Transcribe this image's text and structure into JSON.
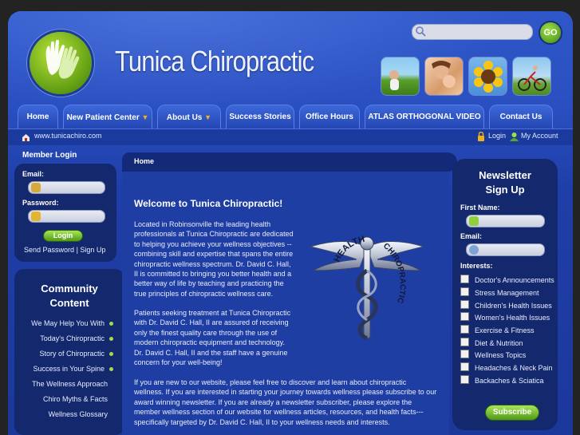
{
  "site": {
    "title": "Tunica Chiropractic",
    "url": "www.tunicachiro.com"
  },
  "search": {
    "placeholder": "",
    "go_label": "GO"
  },
  "nav": {
    "tabs": [
      {
        "label": "Home",
        "dropdown": false
      },
      {
        "label": "New Patient Center",
        "dropdown": true
      },
      {
        "label": "About Us",
        "dropdown": true
      },
      {
        "label": "Success Stories",
        "dropdown": false
      },
      {
        "label": "Office Hours",
        "dropdown": false
      },
      {
        "label": "ATLAS ORTHOGONAL VIDEO",
        "dropdown": false
      },
      {
        "label": "Contact Us",
        "dropdown": false
      }
    ],
    "dropdown_arrow": "▼"
  },
  "account": {
    "login": "Login",
    "my_account": "My Account"
  },
  "member_login": {
    "heading": "Member Login",
    "email_label": "Email:",
    "password_label": "Password:",
    "login_button": "Login",
    "send_password": "Send Password",
    "separator": "|",
    "sign_up": "Sign Up"
  },
  "community": {
    "heading_line1": "Community",
    "heading_line2": "Content",
    "items": [
      "We May Help You With",
      "Today's Chiropractic",
      "Story of Chiropractic",
      "Success in Your Spine",
      "The Wellness Approach",
      "Chiro Myths & Facts",
      "Wellness Glossary"
    ]
  },
  "breadcrumb": "Home",
  "content": {
    "heading": "Welcome to Tunica Chiropractic!",
    "para1": "Located in Robinsonville the leading health professionals at Tunica Chiropractic are dedicated to helping you achieve your wellness objectives -- combining skill and expertise that spans the entire chiropractic wellness spectrum.  Dr. David C. Hall, II is committed to bringing you better health and a better way of life by teaching and practicing the true principles of chiropractic wellness care.",
    "para2": "Patients seeking treatment at Tunica Chiropractic with Dr. David C. Hall, II are assured of receiving only the finest quality care through the use of modern chiropractic equipment and technology.  Dr. David C. Hall, II and the staff have a genuine concern for your well-being!",
    "para3": "If you are new to our website, please feel free to discover and learn about chiropractic wellness. If you are interested in starting your journey towards wellness please subscribe to our award winning newsletter. If you are already a newsletter subscriber, please explore the member wellness section of our website for wellness articles, resources, and health facts---specifically targeted by Dr. David C. Hall, II to your wellness needs and interests.",
    "emblem_top": "HEALTH",
    "emblem_bottom": "CHIROPRACTIC"
  },
  "newsletter": {
    "heading_line1": "Newsletter",
    "heading_line2": "Sign Up",
    "first_name_label": "First Name:",
    "email_label": "Email:",
    "interests_label": "Interests:",
    "interests": [
      "Doctor's Announcements",
      "Stress Management",
      "Children's Health Issues",
      "Women's Health Issues",
      "Exercise & Fitness",
      "Diet & Nutrition",
      "Wellness Topics",
      "Headaches & Neck Pain",
      "Backaches & Sciatica"
    ],
    "subscribe_button": "Subscribe"
  },
  "colors": {
    "frame_blue": "#2a4fc0",
    "panel_navy": "#14286e",
    "accent_green": "#7cc22e",
    "dropdown_orange": "#f2b11b"
  }
}
